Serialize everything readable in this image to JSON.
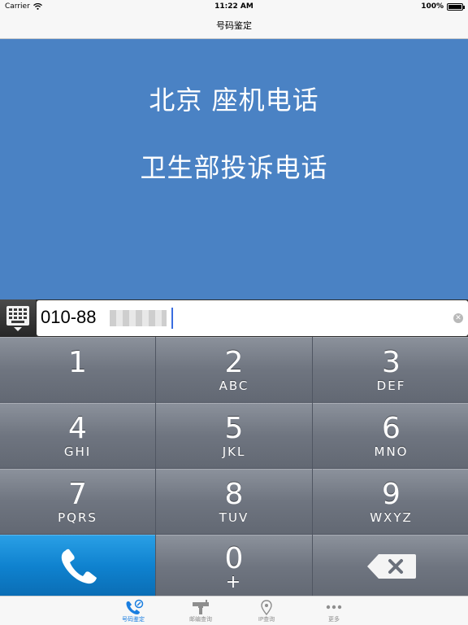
{
  "status_bar": {
    "carrier": "Carrier",
    "time": "11:22 AM",
    "battery": "100%"
  },
  "nav": {
    "title": "号码鉴定"
  },
  "result": {
    "location": "北京 座机电话",
    "owner": "卫生部投诉电话"
  },
  "input": {
    "value": "010-88"
  },
  "keypad": {
    "keys": [
      {
        "digit": "1",
        "letters": ""
      },
      {
        "digit": "2",
        "letters": "ABC"
      },
      {
        "digit": "3",
        "letters": "DEF"
      },
      {
        "digit": "4",
        "letters": "GHI"
      },
      {
        "digit": "5",
        "letters": "JKL"
      },
      {
        "digit": "6",
        "letters": "MNO"
      },
      {
        "digit": "7",
        "letters": "PQRS"
      },
      {
        "digit": "8",
        "letters": "TUV"
      },
      {
        "digit": "9",
        "letters": "WXYZ"
      },
      {
        "digit": "0",
        "letters": "+"
      }
    ]
  },
  "tabs": [
    {
      "label": "号码鉴定",
      "icon": "phone-check-icon",
      "active": true
    },
    {
      "label": "邮编查询",
      "icon": "mailbox-icon",
      "active": false
    },
    {
      "label": "IP查询",
      "icon": "location-pin-icon",
      "active": false
    },
    {
      "label": "更多",
      "icon": "more-icon",
      "active": false
    }
  ],
  "colors": {
    "accent": "#1a7ee0",
    "result_bg": "#4a82c4",
    "call_key": "#1287d2"
  }
}
